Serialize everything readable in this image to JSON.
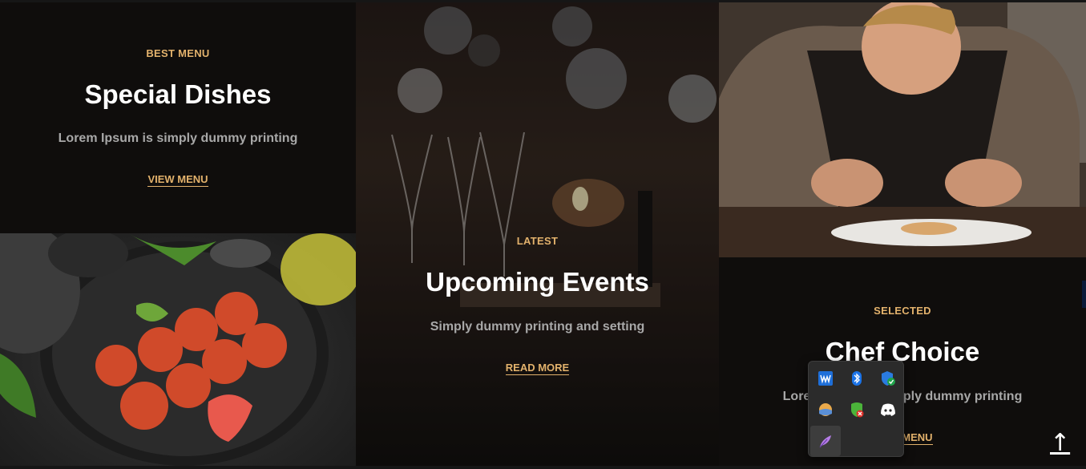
{
  "special": {
    "eyebrow": "BEST MENU",
    "title": "Special Dishes",
    "description": "Lorem Ipsum is simply dummy printing",
    "link": "VIEW MENU"
  },
  "events": {
    "eyebrow": "LATEST",
    "title": "Upcoming Events",
    "description": "Simply dummy printing and setting",
    "link": "READ MORE"
  },
  "chef": {
    "eyebrow": "SELECTED",
    "title": "Chef Choice",
    "description": "Lorem Ipsum is simply dummy printing",
    "link": "VIEW MENU"
  },
  "tray": {
    "icons": [
      "waves-icon",
      "bluetooth-icon",
      "shield-check-icon",
      "weather-icon",
      "security-alert-icon",
      "discord-icon",
      "feather-icon"
    ]
  },
  "scroll_top": {
    "label": "↑"
  },
  "colors": {
    "accent": "#e3b26c",
    "panel": "#0f0d0c",
    "title": "#ffffff",
    "muted": "#a8a8a8"
  }
}
